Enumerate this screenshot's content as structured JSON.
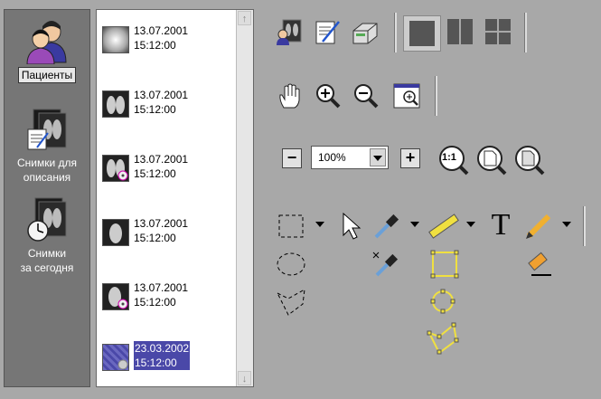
{
  "nav": {
    "patients": "Пациенты",
    "for_description": [
      "Снимки для",
      "описания"
    ],
    "today": [
      "Снимки",
      "за сегодня"
    ]
  },
  "list": {
    "items": [
      {
        "date": "13.07.2001",
        "time": "15:12:00",
        "selected": false
      },
      {
        "date": "13.07.2001",
        "time": "15:12:00",
        "selected": false
      },
      {
        "date": "13.07.2001",
        "time": "15:12:00",
        "selected": false
      },
      {
        "date": "13.07.2001",
        "time": "15:12:00",
        "selected": false
      },
      {
        "date": "13.07.2001",
        "time": "15:12:00",
        "selected": false
      },
      {
        "date": "23.03.2002",
        "time": "15:12:00",
        "selected": true
      }
    ],
    "scroll_up": "↑",
    "scroll_down": "↓"
  },
  "toolbar": {
    "zoom_value": "100%",
    "one_to_one": "1:1",
    "minus": "−",
    "plus": "+",
    "text_tool": "T"
  }
}
